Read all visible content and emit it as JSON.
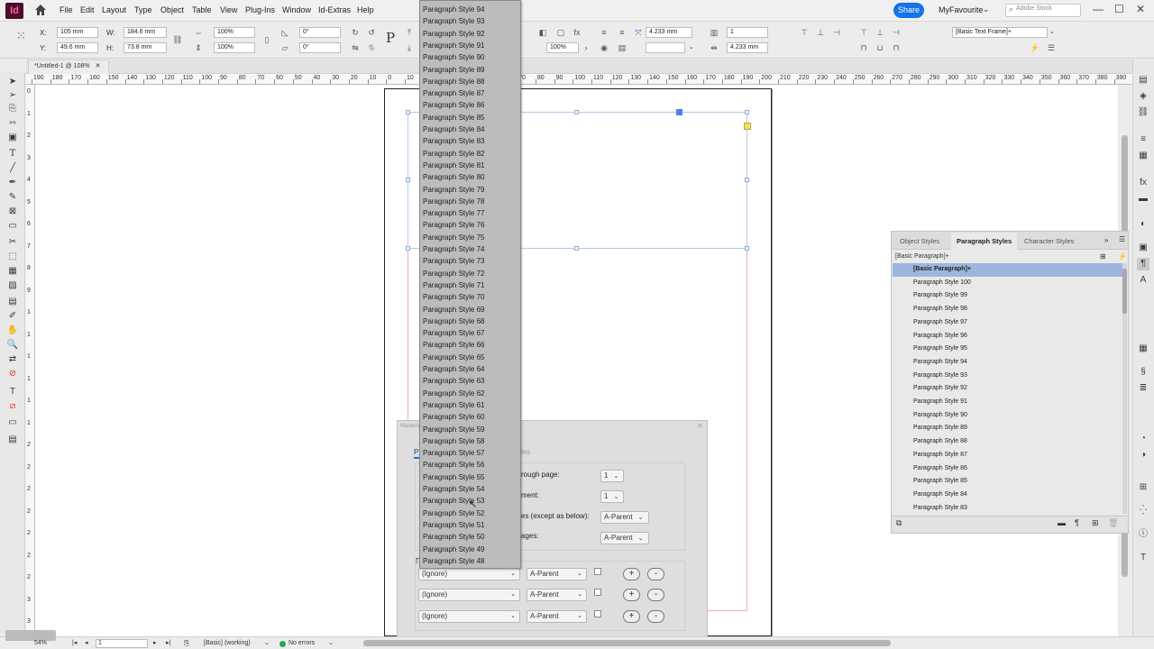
{
  "app": {
    "logo": "Id"
  },
  "menu": [
    "File",
    "Edit",
    "Layout",
    "Type",
    "Object",
    "Table",
    "View",
    "Plug-Ins",
    "Window",
    "Id-Extras",
    "Help"
  ],
  "topright": {
    "share": "Share",
    "workspace": "MyFavourite",
    "search_placeholder": "Adobe Stock"
  },
  "control": {
    "x_label": "X:",
    "x_value": "105 mm",
    "y_label": "Y:",
    "y_value": "49.6 mm",
    "w_label": "W:",
    "w_value": "184.6 mm",
    "h_label": "H:",
    "h_value": "73.8 mm",
    "scale_x": "100%",
    "scale_y": "100%",
    "rotate": "0°",
    "shear": "0°",
    "stroke_weight": "4.233 mm",
    "opacity": "100%",
    "columns": "1",
    "gutter": "4.233 mm",
    "frame_style": "[Basic Text Frame]+"
  },
  "doc_tab": "*Untitled-1 @ 108%",
  "ruler": [
    "190",
    "180",
    "170",
    "160",
    "150",
    "140",
    "130",
    "120",
    "110",
    "100",
    "90",
    "80",
    "70",
    "60",
    "50",
    "40",
    "30",
    "20",
    "10",
    "0",
    "10",
    "20",
    "30",
    "40",
    "50",
    "60",
    "70",
    "80",
    "90",
    "100",
    "110",
    "120",
    "130",
    "140",
    "150",
    "160",
    "170",
    "180",
    "190",
    "200",
    "210",
    "220",
    "230",
    "240",
    "250",
    "260",
    "270",
    "280",
    "290",
    "300",
    "310",
    "320",
    "330",
    "340",
    "350",
    "360",
    "370",
    "380",
    "390"
  ],
  "vruler": [
    "0",
    "1",
    "2",
    "3",
    "4",
    "5",
    "6",
    "7",
    "8",
    "9",
    "1",
    "1",
    "1",
    "1",
    "1",
    "1",
    "2",
    "2",
    "2",
    "2",
    "2",
    "2",
    "2",
    "3",
    "3"
  ],
  "panel": {
    "tabs": [
      "Object Styles",
      "Paragraph Styles",
      "Character Styles"
    ],
    "current": "[Basic Paragraph]+",
    "styles": [
      "[Basic Paragraph]+",
      "Paragraph Style 100",
      "Paragraph Style 99",
      "Paragraph Style 98",
      "Paragraph Style 97",
      "Paragraph Style 96",
      "Paragraph Style 95",
      "Paragraph Style 94",
      "Paragraph Style 93",
      "Paragraph Style 92",
      "Paragraph Style 91",
      "Paragraph Style 90",
      "Paragraph Style 89",
      "Paragraph Style 88",
      "Paragraph Style 87",
      "Paragraph Style 86",
      "Paragraph Style 85",
      "Paragraph Style 84",
      "Paragraph Style 83"
    ]
  },
  "dialog": {
    "title": "Mastering…",
    "tab2": "les",
    "rows": [
      {
        "label": "rough page:",
        "value": "1"
      },
      {
        "label": "ment:",
        "value": "1"
      },
      {
        "label": "es (except as below):",
        "value": "A-Parent"
      },
      {
        "label": "ages:",
        "value": "A-Parent"
      }
    ],
    "left_char": "P",
    "left_char2": "F",
    "ignore": "(Ignore)",
    "parent": "A-Parent",
    "plus": "+",
    "minus": "-"
  },
  "dropdown": [
    "Paragraph Style 94",
    "Paragraph Style 93",
    "Paragraph Style 92",
    "Paragraph Style 91",
    "Paragraph Style 90",
    "Paragraph Style 89",
    "Paragraph Style 88",
    "Paragraph Style 87",
    "Paragraph Style 86",
    "Paragraph Style 85",
    "Paragraph Style 84",
    "Paragraph Style 83",
    "Paragraph Style 82",
    "Paragraph Style 81",
    "Paragraph Style 80",
    "Paragraph Style 79",
    "Paragraph Style 78",
    "Paragraph Style 77",
    "Paragraph Style 76",
    "Paragraph Style 75",
    "Paragraph Style 74",
    "Paragraph Style 73",
    "Paragraph Style 72",
    "Paragraph Style 71",
    "Paragraph Style 70",
    "Paragraph Style 69",
    "Paragraph Style 68",
    "Paragraph Style 67",
    "Paragraph Style 66",
    "Paragraph Style 65",
    "Paragraph Style 64",
    "Paragraph Style 63",
    "Paragraph Style 62",
    "Paragraph Style 61",
    "Paragraph Style 60",
    "Paragraph Style 59",
    "Paragraph Style 58",
    "Paragraph Style 57",
    "Paragraph Style 56",
    "Paragraph Style 55",
    "Paragraph Style 54",
    "Paragraph Style 53",
    "Paragraph Style 52",
    "Paragraph Style 51",
    "Paragraph Style 50",
    "Paragraph Style 49",
    "Paragraph Style 48"
  ],
  "status": {
    "zoom": "54%",
    "page": "1",
    "style": "[Basic] (working)",
    "errors": "No errors"
  },
  "colors": {
    "accent": "#1473e6",
    "selected_row": "#9cb7de",
    "margin": "#e9a9d8",
    "ok": "#2ea44f"
  }
}
